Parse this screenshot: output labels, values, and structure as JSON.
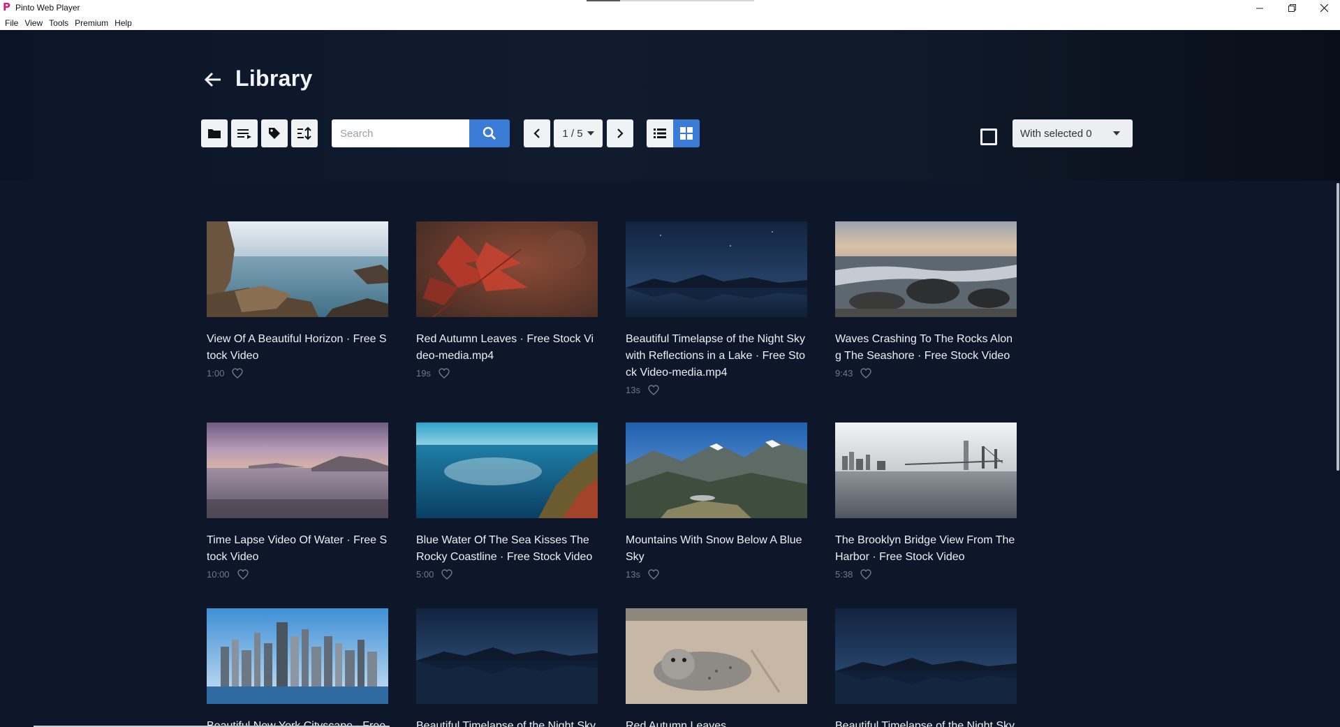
{
  "window": {
    "app_name": "Pinto Web Player",
    "controls": [
      "minimize",
      "restore",
      "close"
    ]
  },
  "menu": [
    "File",
    "View",
    "Tools",
    "Premium",
    "Help"
  ],
  "header": {
    "title": "Library",
    "search": {
      "placeholder": "Search",
      "value": ""
    },
    "pager": {
      "current": "1 / 5"
    },
    "view_mode": "grid",
    "bulk_action": {
      "label": "With selected 0"
    }
  },
  "toolbar_icons": [
    "folder-icon",
    "playlist-icon",
    "tag-icon",
    "sort-icon"
  ],
  "colors": {
    "accent": "#3a7bd5",
    "background": "#0d1729",
    "meta_text": "#6e7a8c"
  },
  "items": [
    {
      "title": "View Of A Beautiful Horizon · Free Stock Video",
      "duration": "1:00",
      "thumb": "rocky-sea-horizon"
    },
    {
      "title": "Red Autumn Leaves · Free Stock Video-media.mp4",
      "duration": "19s",
      "thumb": "red-autumn-leaves"
    },
    {
      "title": "Beautiful Timelapse of the Night Sky with Reflections in a Lake · Free Stock Video-media.mp4",
      "duration": "13s",
      "thumb": "night-sky-lake"
    },
    {
      "title": "Waves Crashing To The Rocks Along The Seashore · Free Stock Video",
      "duration": "9:43",
      "thumb": "waves-rocks-sunset"
    },
    {
      "title": "Time Lapse Video Of Water · Free Stock Video",
      "duration": "10:00",
      "thumb": "purple-dusk-water"
    },
    {
      "title": "Blue Water Of The Sea Kisses The Rocky Coastline · Free Stock Video",
      "duration": "5:00",
      "thumb": "blue-sea-coastline"
    },
    {
      "title": "Mountains With Snow Below A Blue Sky",
      "duration": "13s",
      "thumb": "snowy-mountains"
    },
    {
      "title": "The Brooklyn Bridge View From The Harbor · Free Stock Video",
      "duration": "5:38",
      "thumb": "brooklyn-bridge"
    },
    {
      "title": "Beautiful New York Cityscape · Free Stock Video",
      "duration": "",
      "thumb": "new-york-skyline"
    },
    {
      "title": "Beautiful Timelapse of the Night Sky",
      "duration": "",
      "thumb": "night-sky-lake"
    },
    {
      "title": "Red Autumn Leaves",
      "duration": "",
      "thumb": "seal-on-beach"
    },
    {
      "title": "Beautiful Timelapse of the Night Sky",
      "duration": "",
      "thumb": "night-sky-lake"
    }
  ]
}
